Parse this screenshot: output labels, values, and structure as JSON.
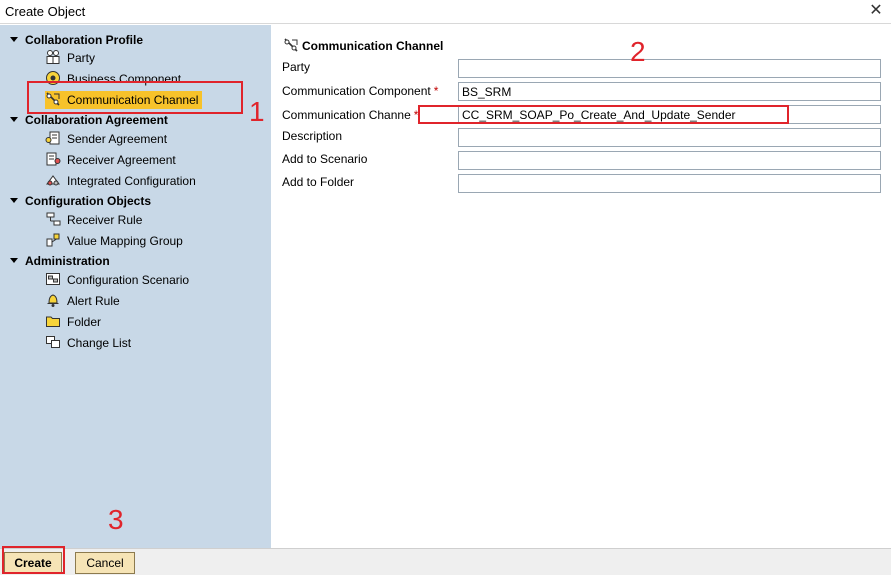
{
  "window": {
    "title": "Create Object",
    "close_glyph": "✕"
  },
  "sidebar": {
    "groups": [
      {
        "label": "Collaboration Profile",
        "items": [
          {
            "label": "Party",
            "icon": "party-icon"
          },
          {
            "label": "Business Component",
            "icon": "business-component-icon"
          },
          {
            "label": "Communication Channel",
            "icon": "communication-channel-icon",
            "selected": true
          }
        ]
      },
      {
        "label": "Collaboration Agreement",
        "items": [
          {
            "label": "Sender Agreement",
            "icon": "sender-agreement-icon"
          },
          {
            "label": "Receiver Agreement",
            "icon": "receiver-agreement-icon"
          },
          {
            "label": "Integrated Configuration",
            "icon": "integrated-configuration-icon"
          }
        ]
      },
      {
        "label": "Configuration Objects",
        "items": [
          {
            "label": "Receiver Rule",
            "icon": "receiver-rule-icon"
          },
          {
            "label": "Value Mapping Group",
            "icon": "value-mapping-group-icon"
          }
        ]
      },
      {
        "label": "Administration",
        "items": [
          {
            "label": "Configuration Scenario",
            "icon": "configuration-scenario-icon"
          },
          {
            "label": "Alert Rule",
            "icon": "alert-rule-icon"
          },
          {
            "label": "Folder",
            "icon": "folder-icon"
          },
          {
            "label": "Change List",
            "icon": "change-list-icon"
          }
        ]
      }
    ]
  },
  "main": {
    "header": "Communication Channel",
    "fields": [
      {
        "label": "Party",
        "required": false,
        "value": ""
      },
      {
        "label": "Communication Component",
        "required": true,
        "value": "BS_SRM"
      },
      {
        "label": "Communication Channe",
        "required": true,
        "value": "CC_SRM_SOAP_Po_Create_And_Update_Sender"
      },
      {
        "label": "Description",
        "required": false,
        "value": ""
      },
      {
        "label": "Add to Scenario",
        "required": false,
        "value": ""
      },
      {
        "label": "Add to Folder",
        "required": false,
        "value": ""
      }
    ],
    "required_mark": "*"
  },
  "footer": {
    "create_label": "Create",
    "cancel_label": "Cancel"
  },
  "annotations": [
    "1",
    "2",
    "3"
  ],
  "colors": {
    "sidebar_bg": "#c8d8e7",
    "selected_bg": "#f7c22a",
    "annotation_red": "#e0242b",
    "button_bg": "#f6e4b6"
  }
}
